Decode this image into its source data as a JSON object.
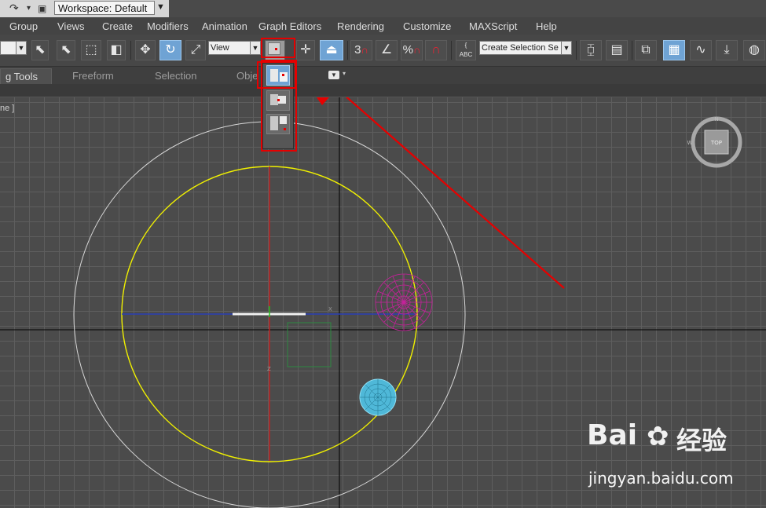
{
  "titlebar": {
    "workspace_label": "Workspace: Default",
    "redo_icon": "redo-icon",
    "project_icon": "project-folder-icon"
  },
  "menu": {
    "items": [
      "Group",
      "Views",
      "Create",
      "Modifiers",
      "Animation",
      "Graph Editors",
      "Rendering",
      "Customize",
      "MAXScript",
      "Help"
    ]
  },
  "toolbar": {
    "reference_coord": "View",
    "named_selection_placeholder": "Create Selection Se",
    "snap_angle_label": "3",
    "percent_snap_label": "%",
    "abc_label": "ABC"
  },
  "ribbon": {
    "tabs": [
      "g Tools",
      "Freeform",
      "Selection",
      "Obje"
    ]
  },
  "viewport": {
    "label": "ne ]",
    "viewcube_label": "TOP",
    "axis_x_label": "X",
    "axis_z_label": "Z"
  },
  "flyout": {
    "active_item": "pivot-point-center",
    "items": [
      "use-pivot-point-center",
      "use-selection-center",
      "use-transform-coordinate-center"
    ]
  },
  "watermark": {
    "logo_text": "Bai",
    "logo_cn": "经验",
    "url": "jingyan.baidu.com"
  },
  "colors": {
    "annotation": "#e60000",
    "active_button": "#6fa3d4",
    "orbit_outer": "#d8d8d8",
    "orbit_inner": "#f0f000",
    "sphere_magenta": "#c8209c",
    "sphere_cyan": "#58c8e8",
    "axis_blue": "#2a3fb4",
    "axis_red": "#c81e1e"
  }
}
